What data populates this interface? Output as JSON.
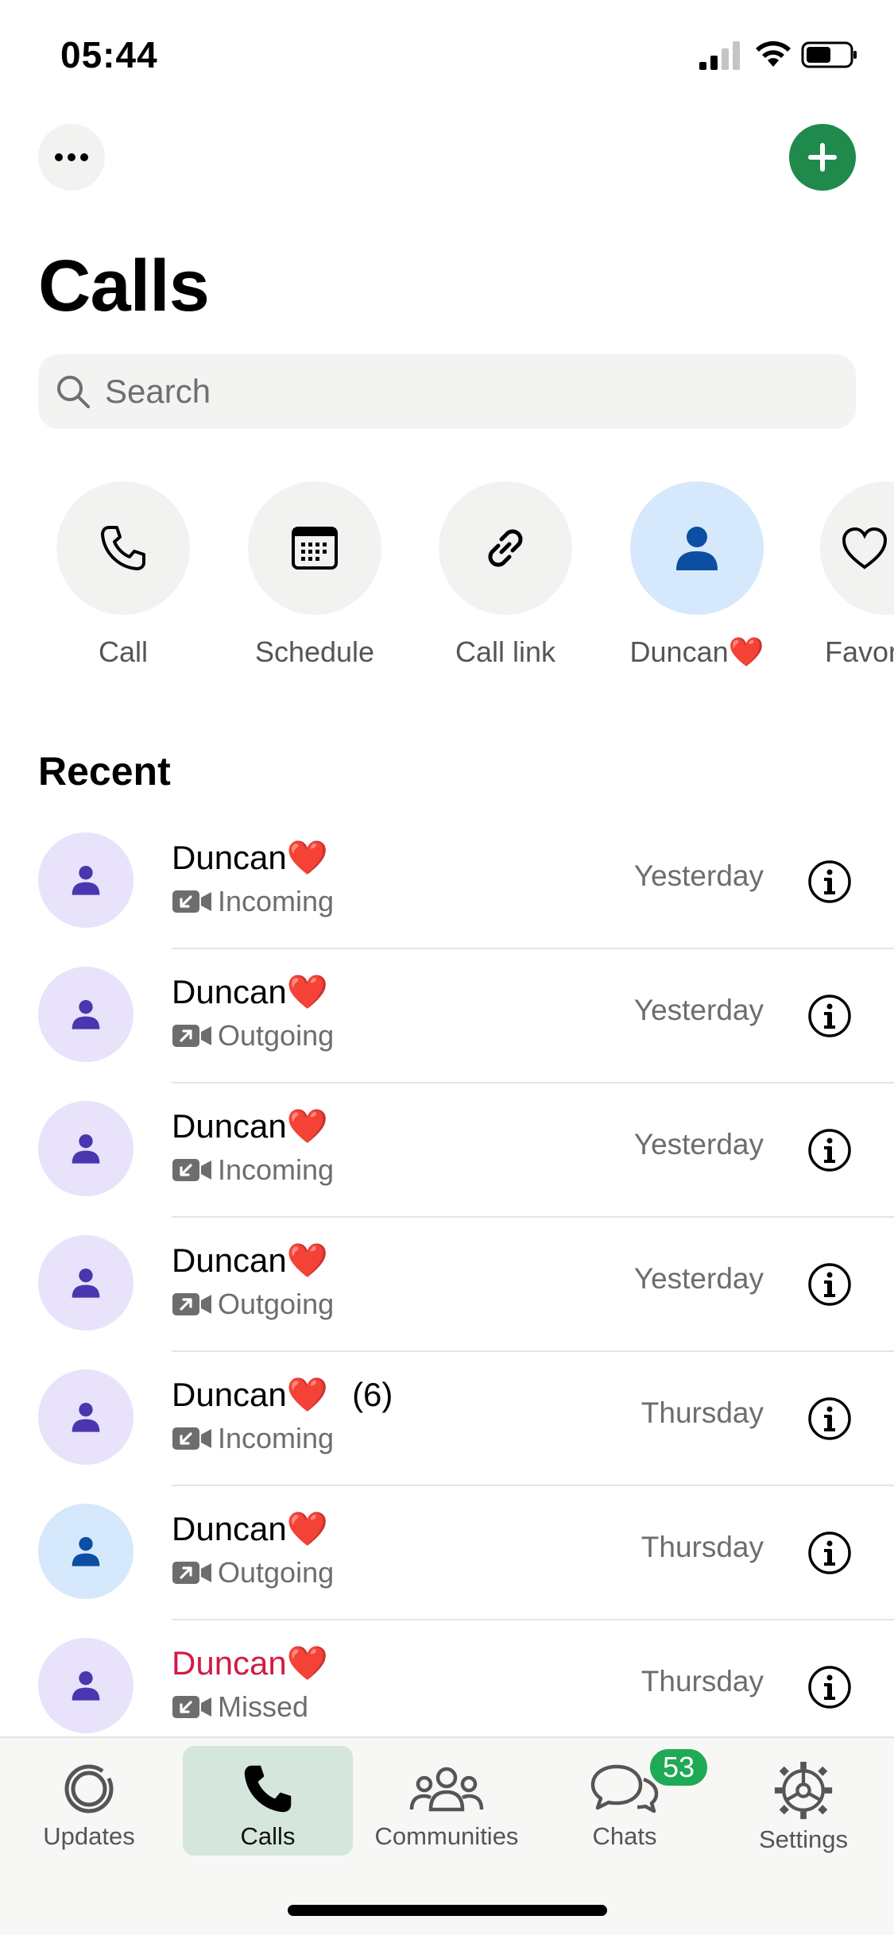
{
  "status_bar": {
    "time": "05:44"
  },
  "header": {
    "title": "Calls"
  },
  "search": {
    "placeholder": "Search"
  },
  "quick_actions": [
    {
      "label": "Call",
      "icon": "phone-icon"
    },
    {
      "label": "Schedule",
      "icon": "calendar-icon"
    },
    {
      "label": "Call link",
      "icon": "link-icon"
    },
    {
      "label": "Duncan❤️",
      "icon": "person-icon"
    },
    {
      "label": "Favorites",
      "icon": "heart-icon"
    }
  ],
  "recent": {
    "title": "Recent",
    "items": [
      {
        "name": "Duncan❤️",
        "count": "",
        "type": "Incoming",
        "time": "Yesterday",
        "missed": false
      },
      {
        "name": "Duncan❤️",
        "count": "",
        "type": "Outgoing",
        "time": "Yesterday",
        "missed": false
      },
      {
        "name": "Duncan❤️",
        "count": "",
        "type": "Incoming",
        "time": "Yesterday",
        "missed": false
      },
      {
        "name": "Duncan❤️",
        "count": "",
        "type": "Outgoing",
        "time": "Yesterday",
        "missed": false
      },
      {
        "name": "Duncan❤️",
        "count": "(6)",
        "type": "Incoming",
        "time": "Thursday",
        "missed": false
      },
      {
        "name": "Duncan❤️",
        "count": "",
        "type": "Outgoing",
        "time": "Thursday",
        "missed": false
      },
      {
        "name": "Duncan❤️",
        "count": "",
        "type": "Missed",
        "time": "Thursday",
        "missed": true
      }
    ]
  },
  "tabbar": {
    "tabs": [
      {
        "label": "Updates",
        "icon": "updates-icon"
      },
      {
        "label": "Calls",
        "icon": "phone-filled-icon",
        "active": true
      },
      {
        "label": "Communities",
        "icon": "communities-icon"
      },
      {
        "label": "Chats",
        "icon": "chats-icon",
        "badge": "53"
      },
      {
        "label": "Settings",
        "icon": "gear-icon"
      }
    ]
  },
  "colors": {
    "accent_green": "#1f8a4c",
    "badge_green": "#1faa55",
    "missed_red": "#d11b45",
    "avatar_purple": "#e8e2fb",
    "avatar_blue": "#d6e8fb"
  }
}
